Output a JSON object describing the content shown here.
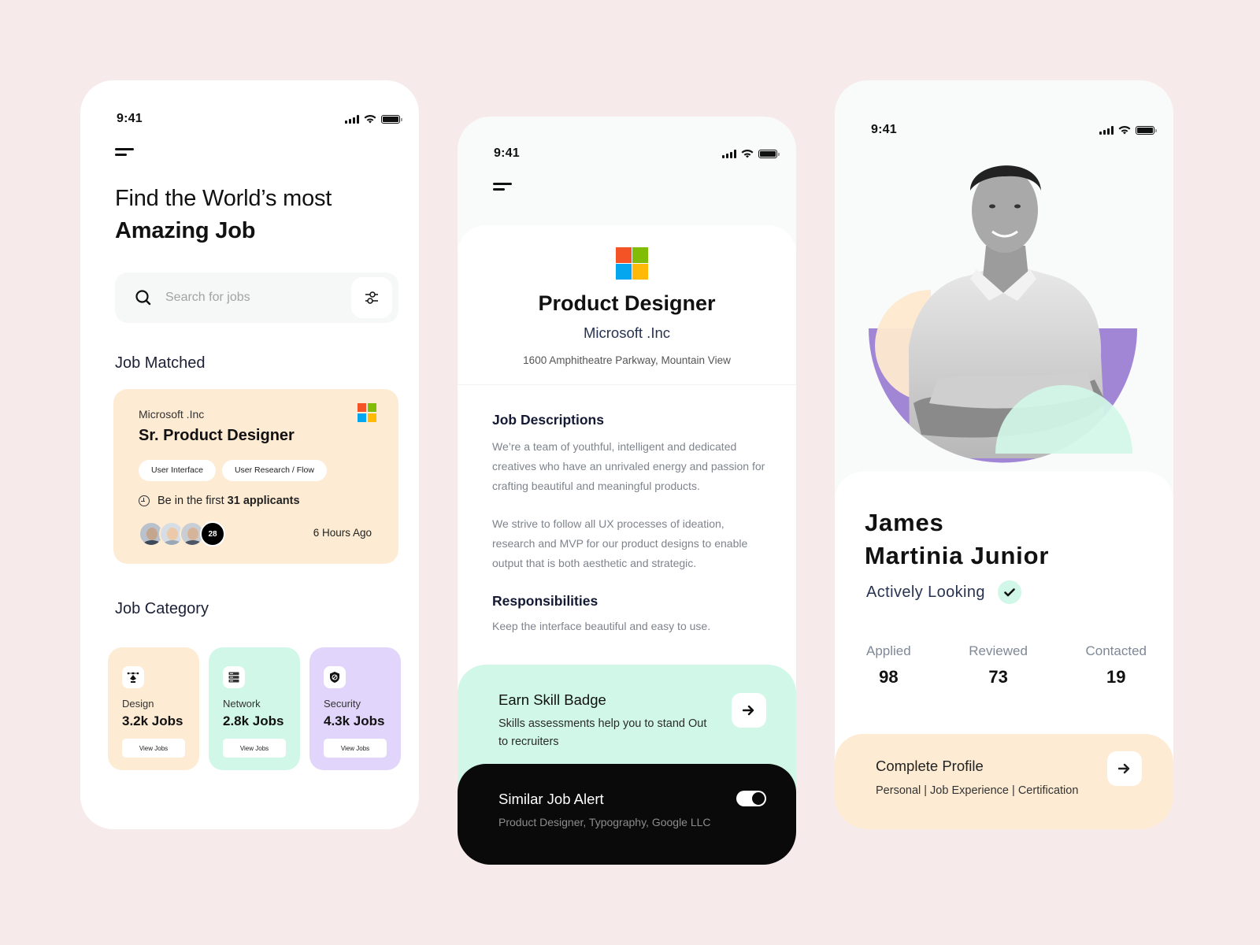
{
  "status_bar": {
    "time": "9:41"
  },
  "home": {
    "title_line1": "Find the World’s most",
    "title_line2": "Amazing Job",
    "search": {
      "placeholder": "Search for jobs",
      "value": ""
    },
    "job_matched": {
      "heading": "Job Matched",
      "company": "Microsoft .Inc",
      "title": "Sr. Product Designer",
      "tags": [
        "User Interface",
        "User Research / Flow"
      ],
      "applicants_prefix": "Be in the first",
      "applicants_count": "31 applicants",
      "more_applicants": "28",
      "posted": "6 Hours Ago"
    },
    "job_category": {
      "heading": "Job Category",
      "items": [
        {
          "name": "Design",
          "count": "3.2k Jobs",
          "button": "View Jobs",
          "icon": "pen-tool-icon",
          "color": "#fdebd3"
        },
        {
          "name": "Network",
          "count": "2.8k Jobs",
          "button": "View Jobs",
          "icon": "server-icon",
          "color": "#d1f7e8"
        },
        {
          "name": "Security",
          "count": "4.3k Jobs",
          "button": "View Jobs",
          "icon": "shield-icon",
          "color": "#e2d5fb"
        }
      ]
    }
  },
  "detail": {
    "title": "Product Designer",
    "company": "Microsoft .Inc",
    "address": "1600 Amphitheatre Parkway, Mountain View",
    "descriptions_heading": "Job Descriptions",
    "description_p1": "We’re a team of youthful, intelligent and dedicated creatives who have an unrivaled energy and passion for crafting beautiful and meaningful products.",
    "description_p2": "We strive to follow all UX processes of ideation, research and MVP for our product designs to enable output that is both aesthetic and strategic.",
    "responsibilities_heading": "Responsibilities",
    "responsibilities_text": "Keep the interface beautiful and easy to use.",
    "skill_badge": {
      "title": "Earn Skill Badge",
      "subtitle": "Skills assessments help you to stand Out to recruiters"
    },
    "job_alert": {
      "title": "Similar Job Alert",
      "subtitle": "Product Designer, Typography, Google LLC",
      "enabled": true
    }
  },
  "profile": {
    "first_name": "James",
    "last_name": "Martinia Junior",
    "status": "Actively Looking",
    "stats": [
      {
        "label": "Applied",
        "value": "98"
      },
      {
        "label": "Reviewed",
        "value": "73"
      },
      {
        "label": "Contacted",
        "value": "19"
      }
    ],
    "complete": {
      "title": "Complete Profile",
      "subtitle": "Personal | Job Experience | Certification"
    }
  },
  "colors": {
    "background": "#f7eaea",
    "peach": "#fdebd3",
    "mint": "#d1f7e8",
    "lavender": "#e2d5fb",
    "purple": "#a286d6",
    "ms_red": "#f35325",
    "ms_green": "#81bc06",
    "ms_blue": "#05a6f0",
    "ms_yellow": "#ffba08"
  }
}
